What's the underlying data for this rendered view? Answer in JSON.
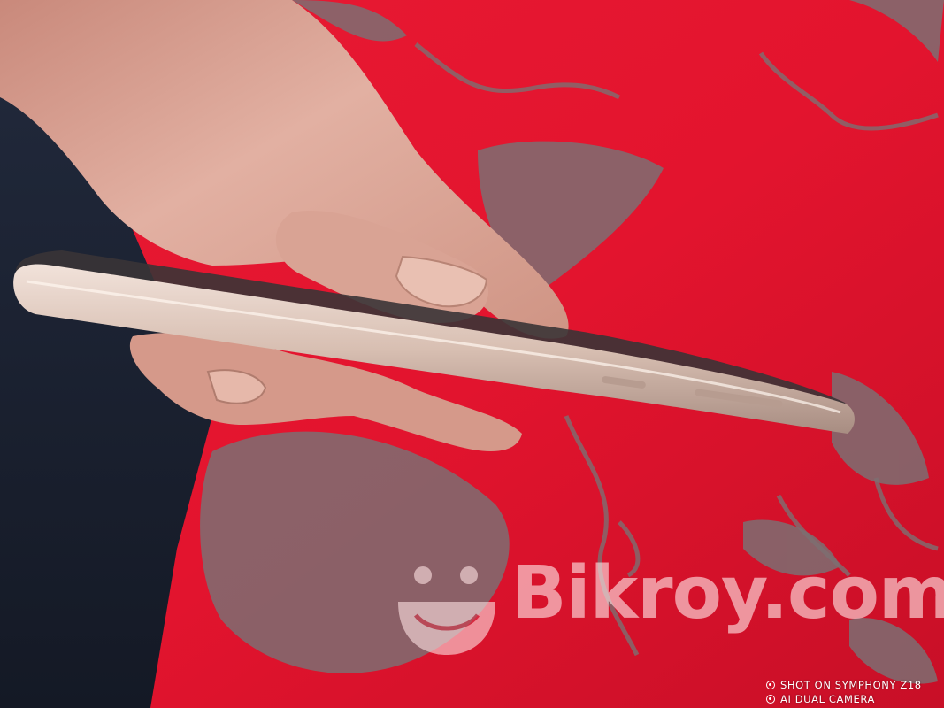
{
  "photo": {
    "subject": "smartphone-side-view-held-in-hand",
    "colors": {
      "cloth_red": "#e3142e",
      "cloth_pattern": "#7d6f72",
      "dark_fabric": "#1b2131",
      "skin": "#d9a394",
      "phone_frame": "#d8bfb2"
    }
  },
  "watermark": {
    "brand_text": "Bikroy.com",
    "icon": "smiley-bag-icon"
  },
  "camera_stamp": {
    "line1": "SHOT ON SYMPHONY Z18",
    "line2": "AI DUAL CAMERA",
    "icon": "camera-lens-icon"
  }
}
